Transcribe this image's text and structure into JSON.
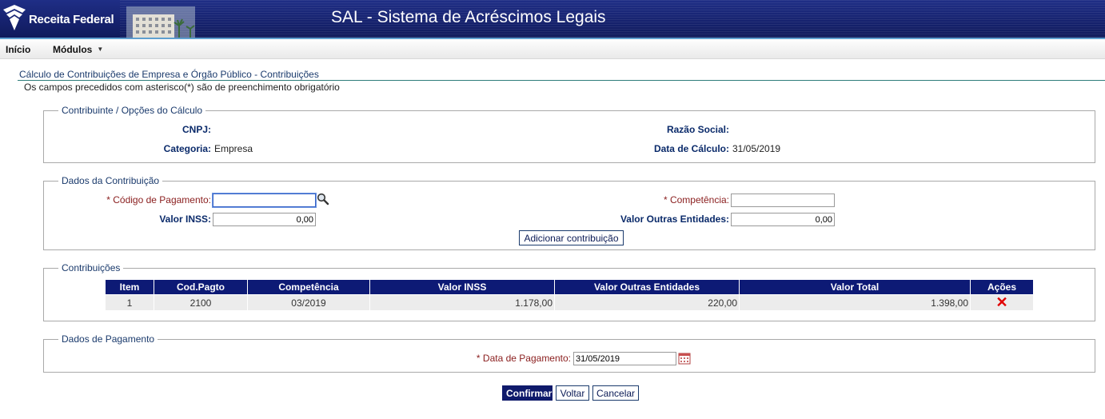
{
  "header": {
    "logo_text": "Receita Federal",
    "title": "SAL - Sistema de Acréscimos Legais"
  },
  "menu": {
    "inicio": "Início",
    "modulos": "Módulos"
  },
  "page": {
    "title": "Cálculo de Contribuições de Empresa e Órgão Público - Contribuições",
    "subtitle": "Os campos precedidos com asterisco(*) são de preenchimento obrigatório"
  },
  "contribuinte": {
    "legend": "Contribuinte / Opções do Cálculo",
    "cnpj_label": "CNPJ:",
    "cnpj_value": "",
    "razao_label": "Razão Social:",
    "razao_value": "",
    "categoria_label": "Categoria:",
    "categoria_value": "Empresa",
    "data_calculo_label": "Data de Cálculo:",
    "data_calculo_value": "31/05/2019"
  },
  "dados_contribuicao": {
    "legend": "Dados da Contribuição",
    "codigo_label": "* Código de Pagamento:",
    "codigo_value": "",
    "competencia_label": "* Competência:",
    "competencia_value": "",
    "valor_inss_label": "Valor INSS:",
    "valor_inss_value": "0,00",
    "valor_outras_label": "Valor Outras Entidades:",
    "valor_outras_value": "0,00",
    "add_button": "Adicionar contribuição"
  },
  "contribuicoes": {
    "legend": "Contribuições",
    "columns": [
      "Item",
      "Cod.Pagto",
      "Competência",
      "Valor INSS",
      "Valor Outras Entidades",
      "Valor Total",
      "Ações"
    ],
    "rows": [
      {
        "item": "1",
        "cod": "2100",
        "competencia": "03/2019",
        "inss": "1.178,00",
        "outras": "220,00",
        "total": "1.398,00",
        "acao": "✕"
      }
    ]
  },
  "pagamento": {
    "legend": "Dados de Pagamento",
    "data_label": "* Data de Pagamento:",
    "data_value": "31/05/2019"
  },
  "actions": {
    "confirmar": "Confirmar",
    "voltar": "Voltar",
    "cancelar": "Cancelar"
  },
  "colors": {
    "header_blue": "#16226e",
    "table_header": "#0d1a75",
    "required_label": "#8b2020",
    "label_blue": "#0a2a6a",
    "delete_red": "#e00000"
  }
}
